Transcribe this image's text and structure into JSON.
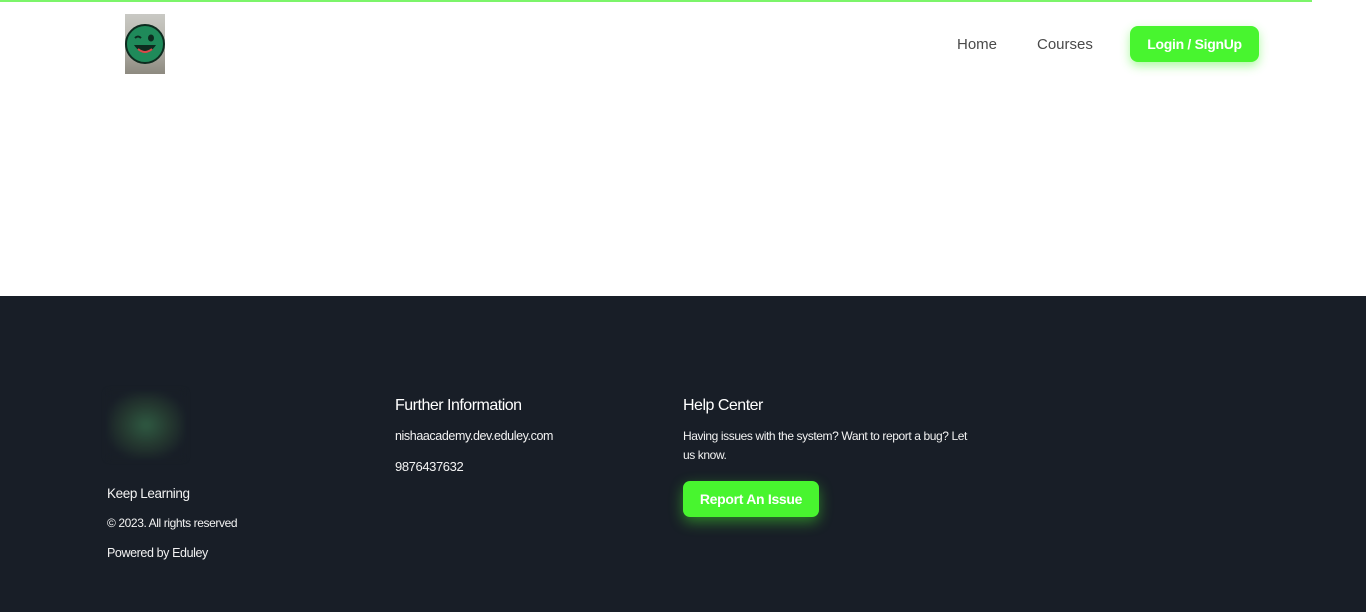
{
  "header": {
    "logo_icon": "smiley-winking-logo-icon",
    "nav": {
      "home_label": "Home",
      "courses_label": "Courses"
    },
    "login_label": "Login / SignUp"
  },
  "footer": {
    "logo_icon": "blurred-logo-icon",
    "tagline": "Keep Learning",
    "copyright": "© 2023. All rights reserved",
    "powered_by": "Powered by Eduley",
    "further_info": {
      "title": "Further Information",
      "email": "nishaacademy.dev.eduley.com",
      "phone": "9876437632"
    },
    "help_center": {
      "title": "Help Center",
      "description": "Having issues with the system? Want to report a bug? Let us know.",
      "report_label": "Report An Issue"
    }
  },
  "colors": {
    "accent": "#48f52f",
    "footer_bg": "#181e27",
    "top_bar": "#7cf56a"
  }
}
